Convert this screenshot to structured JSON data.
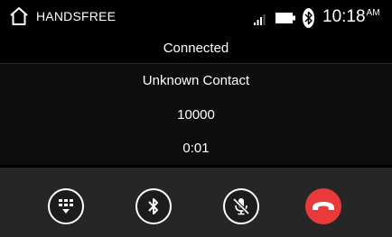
{
  "status_bar": {
    "app_name": "HANDSFREE",
    "time": "10:18",
    "time_suffix": "AM",
    "icons": [
      "home-icon",
      "signal-icon",
      "battery-icon",
      "bluetooth-icon"
    ]
  },
  "call": {
    "state": "Connected",
    "contact_name": "Unknown Contact",
    "number": "10000",
    "duration": "0:01"
  },
  "controls": {
    "buttons": [
      "keypad-icon",
      "bluetooth-icon",
      "mute-microphone-icon",
      "end-call-icon"
    ],
    "end_call_color": "#e8393b"
  },
  "colors": {
    "background": "#000000",
    "info_rows": "#0d0d0d",
    "control_bar": "#262626",
    "text": "#ffffff"
  }
}
